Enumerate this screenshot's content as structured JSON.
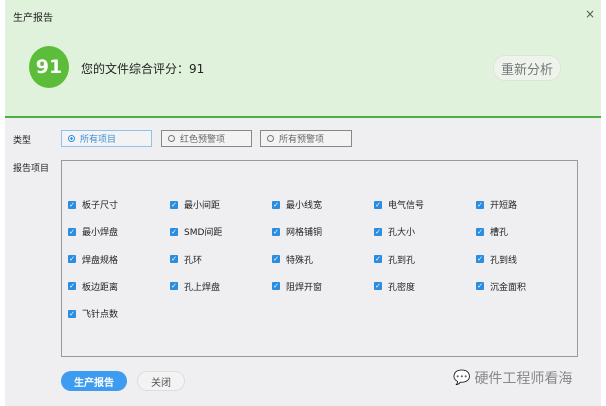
{
  "dialog": {
    "title": "生产报告",
    "close_icon": "×"
  },
  "score": {
    "value": "91",
    "text": "您的文件综合评分：91",
    "reanalyze": "重新分析"
  },
  "type": {
    "label": "类型",
    "options": [
      {
        "label": "所有项目",
        "selected": true
      },
      {
        "label": "红色预警项",
        "selected": false
      },
      {
        "label": "所有预警项",
        "selected": false
      }
    ]
  },
  "report": {
    "label": "报告项目",
    "items": [
      "板子尺寸",
      "最小间距",
      "最小线宽",
      "电气信号",
      "开短路",
      "最小焊盘",
      "SMD间距",
      "网格铺铜",
      "孔大小",
      "槽孔",
      "焊盘规格",
      "孔环",
      "特殊孔",
      "孔到孔",
      "孔到线",
      "板边距离",
      "孔上焊盘",
      "阻焊开窗",
      "孔密度",
      "沉金面积",
      "飞针点数"
    ]
  },
  "footer": {
    "generate": "生产报告",
    "close": "关闭"
  },
  "watermark": "硬件工程师看海"
}
